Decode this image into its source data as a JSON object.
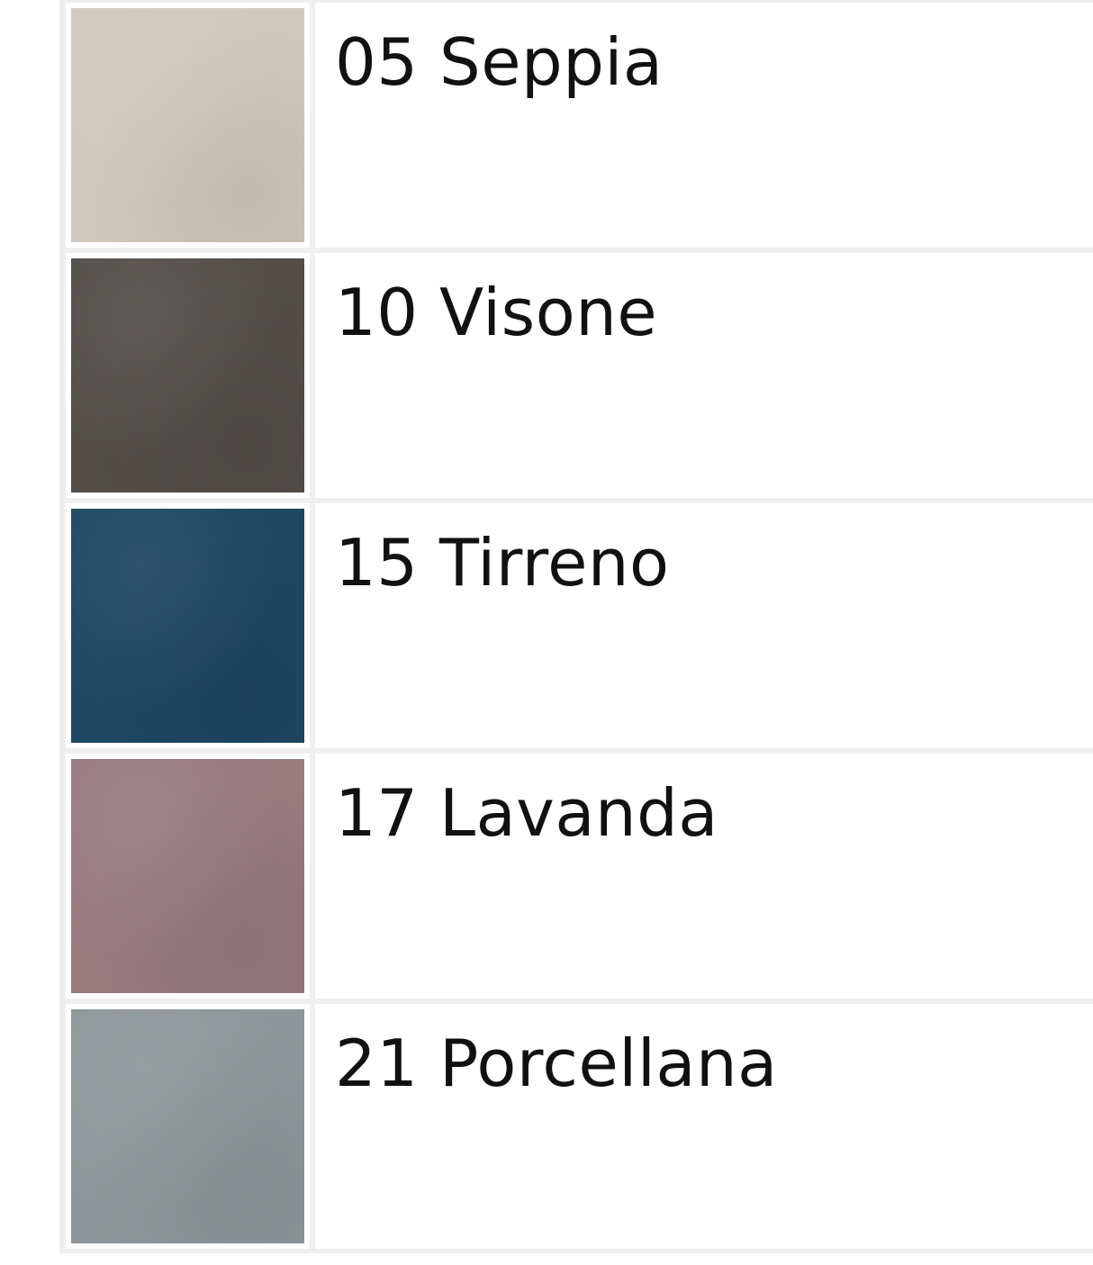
{
  "colors": [
    {
      "name": "05 Seppia",
      "hex": "#d1c8bc"
    },
    {
      "name": "10 Visone",
      "hex": "#534e4a"
    },
    {
      "name": "15 Tirreno",
      "hex": "#1e4762"
    },
    {
      "name": "17 Lavanda",
      "hex": "#987a7f"
    },
    {
      "name": "21 Porcellana",
      "hex": "#8f9699"
    }
  ]
}
